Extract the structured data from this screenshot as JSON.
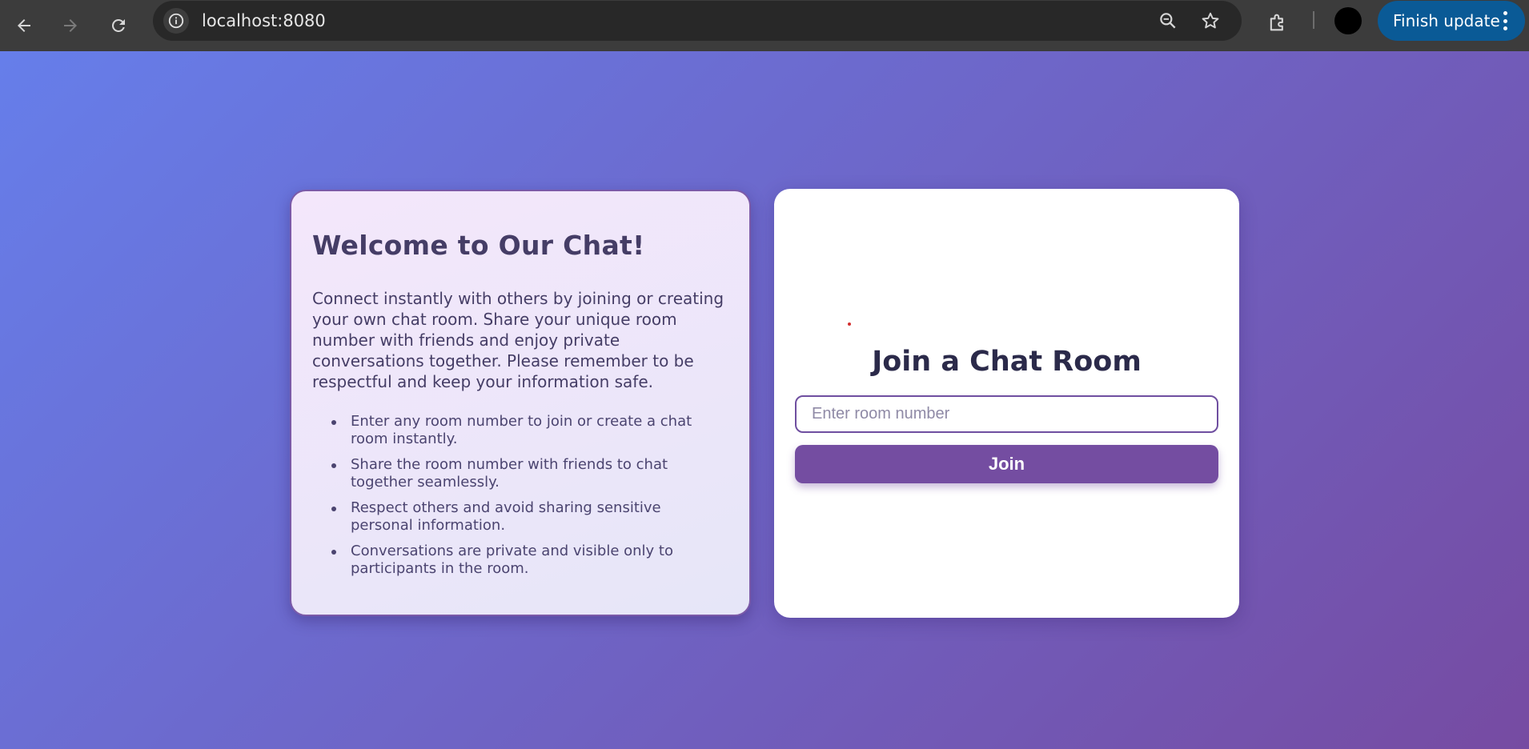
{
  "browser": {
    "url": "localhost:8080",
    "update_button_label": "Finish update",
    "icons": {
      "back": "arrow-back-icon",
      "forward": "arrow-forward-icon",
      "reload": "reload-icon",
      "site_info": "info-icon",
      "zoom": "zoom-icon",
      "bookmark": "star-icon",
      "extensions": "puzzle-icon",
      "menu": "kebab-menu-icon"
    },
    "colors": {
      "toolbar": "#3c3c3c",
      "omnibox": "#282828",
      "update_button": "#0a5a96"
    }
  },
  "page": {
    "background_gradient": [
      "#667eea",
      "#764ba2"
    ],
    "info_card": {
      "title": "Welcome to Our Chat!",
      "description": "Connect instantly with others by joining or creating your own chat room. Share your unique room number with friends and enjoy private conversations together. Please remember to be respectful and keep your information safe.",
      "bullets": [
        "Enter any room number to join or create a chat room instantly.",
        "Share the room number with friends to chat together seamlessly.",
        "Respect others and avoid sharing sensitive personal information.",
        "Conversations are private and visible only to participants in the room."
      ]
    },
    "join_card": {
      "title": "Join a Chat Room",
      "input_placeholder": "Enter room number",
      "input_value": "",
      "button_label": "Join",
      "accent_color": "#744da1"
    }
  }
}
